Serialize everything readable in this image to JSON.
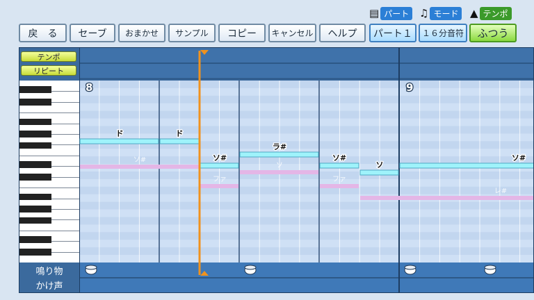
{
  "toolbar": {
    "back": "戻　る",
    "save": "セーブ",
    "omakase": "おまかせ",
    "sample": "サンプル",
    "copy": "コピー",
    "cancel": "キャンセル",
    "help": "ヘルプ",
    "part_value": "パート１",
    "length_value": "１６分音符",
    "mode_value": "ふつう"
  },
  "headers": {
    "part": "パート",
    "mode": "モード",
    "tempo": "テンポ"
  },
  "rows": {
    "tempo": "テンポ",
    "repeat": "リピート",
    "percussion": "鳴り物",
    "shout": "かけ声"
  },
  "measures": [
    "8",
    "9"
  ],
  "notes": [
    {
      "label": "ド",
      "state": "current"
    },
    {
      "label": "ド",
      "state": "current"
    },
    {
      "label": "ソ#",
      "state": "current"
    },
    {
      "label": "ラ#",
      "state": "current"
    },
    {
      "label": "ソ#",
      "state": "current"
    },
    {
      "label": "ソ",
      "state": "current"
    },
    {
      "label": "ソ#",
      "state": "current"
    },
    {
      "label": "ソ#",
      "state": "ghost"
    },
    {
      "label": "ファ",
      "state": "ghost"
    },
    {
      "label": "ソ",
      "state": "ghost"
    },
    {
      "label": "ファ",
      "state": "ghost"
    },
    {
      "label": "レ#",
      "state": "ghost"
    }
  ],
  "colors": {
    "note_current": "#9ff3fb",
    "note_ghost": "#e4b6e6",
    "playhead": "#f0921e",
    "grid_bg": "#c8dbf2"
  }
}
